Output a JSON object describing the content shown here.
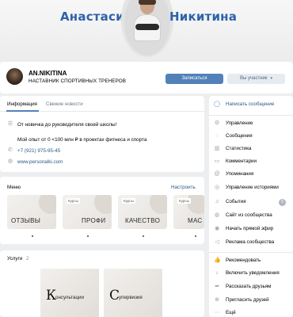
{
  "cover": {
    "first_name": "Анастасия",
    "last_name": "Никитина"
  },
  "profile": {
    "name": "AN.NIKITINA",
    "status": "НАСТАВНИК СПОРТИВНЫХ ТРЕНЕРОВ",
    "subscribe_label": "Записаться",
    "member_label": "Вы участник"
  },
  "info": {
    "tabs": [
      {
        "label": "Информация",
        "active": true
      },
      {
        "label": "Свежие новости",
        "active": false
      }
    ],
    "description_1": "От новичка до руководителя своей школы!",
    "description_2": "Мой опыт от 0 <100 млн ₽ в проектах фитнеса и спорта",
    "phone": "+7 (921) 975-95-45",
    "website": "www.personalki.com"
  },
  "menu": {
    "title": "Меню",
    "setup_label": "Настроить",
    "items": [
      {
        "label": "ОТЗЫВЫ",
        "badge": ""
      },
      {
        "label": "ПРОФИ",
        "badge": "Курсы"
      },
      {
        "label": "КАЧЕСТВО",
        "badge": "Курсы"
      },
      {
        "label": "МАС",
        "badge": "Курсы"
      }
    ]
  },
  "services": {
    "title": "Услуги",
    "count": "2",
    "items": [
      {
        "cap": "К",
        "rest": "онсультации"
      },
      {
        "cap": "С",
        "rest": "упервизия"
      }
    ]
  },
  "sidebar": {
    "items": [
      {
        "label": "Написать сообщение",
        "icon": "message-icon",
        "badge": ""
      },
      {
        "label": "Управление",
        "icon": "gear-icon",
        "badge": ""
      },
      {
        "label": "Сообщения",
        "icon": "chat-icon",
        "badge": ""
      },
      {
        "label": "Статистика",
        "icon": "chart-icon",
        "badge": ""
      },
      {
        "label": "Комментарии",
        "icon": "comment-icon",
        "badge": ""
      },
      {
        "label": "Упоминания",
        "icon": "at-icon",
        "badge": ""
      },
      {
        "label": "Управление историями",
        "icon": "stories-icon",
        "badge": ""
      },
      {
        "label": "События",
        "icon": "bell-icon",
        "badge": "5"
      },
      {
        "label": "Сайт из сообщества",
        "icon": "globe-icon",
        "badge": ""
      },
      {
        "label": "Начать прямой эфир",
        "icon": "live-icon",
        "badge": ""
      },
      {
        "label": "Реклама сообщества",
        "icon": "megaphone-icon",
        "badge": ""
      },
      {
        "label": "Рекомендовать",
        "icon": "thumb-icon",
        "badge": ""
      },
      {
        "label": "Включить уведомления",
        "icon": "notification-icon",
        "badge": ""
      },
      {
        "label": "Рассказать друзьям",
        "icon": "share-icon",
        "badge": ""
      },
      {
        "label": "Пригласить друзей",
        "icon": "invite-icon",
        "badge": ""
      },
      {
        "label": "Ещё",
        "icon": "more-icon",
        "badge": ""
      }
    ]
  }
}
